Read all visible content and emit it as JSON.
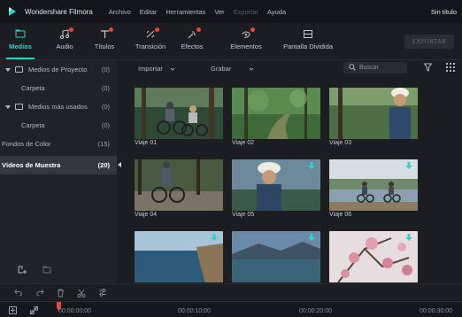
{
  "titlebar": {
    "app_name": "Wondershare Filmora",
    "menu": [
      "Archivo",
      "Editar",
      "Herramientas",
      "Ver",
      "Exportar",
      "Ayuda"
    ],
    "window_title": "Sin título"
  },
  "toolbar": {
    "tools": [
      {
        "label": "Medios",
        "icon": "folder-icon",
        "active": true,
        "dot": false
      },
      {
        "label": "Audio",
        "icon": "music-note-icon",
        "active": false,
        "dot": true
      },
      {
        "label": "Títulos",
        "icon": "title-text-icon",
        "active": false,
        "dot": true
      },
      {
        "label": "Transición",
        "icon": "transition-icon",
        "active": false,
        "dot": true
      },
      {
        "label": "Efectos",
        "icon": "effects-icon",
        "active": false,
        "dot": true
      },
      {
        "label": "Elementos",
        "icon": "elements-icon",
        "active": false,
        "dot": true
      },
      {
        "label": "Pantalla Dividida",
        "icon": "split-screen-icon",
        "active": false,
        "dot": false
      }
    ],
    "export_label": "EXPORTAR"
  },
  "sidebar": {
    "items": [
      {
        "label": "Medios de Proyecto",
        "count": "(0)",
        "type": "group"
      },
      {
        "label": "Carpeta",
        "count": "(0)",
        "type": "child"
      },
      {
        "label": "Medios más usados",
        "count": "(0)",
        "type": "group"
      },
      {
        "label": "Carpeta",
        "count": "(0)",
        "type": "child"
      },
      {
        "label": "Fondos de Color",
        "count": "(15)",
        "type": "root"
      },
      {
        "label": "Vídeos de Muestra",
        "count": "(20)",
        "type": "root",
        "selected": true
      }
    ],
    "bottom_icons": [
      "new-folder-icon",
      "folder-outline-icon"
    ]
  },
  "media": {
    "import_label": "Importar",
    "record_label": "Grabar",
    "search_placeholder": "Buscar",
    "items": [
      {
        "caption": "Viaje 01",
        "scene": "cyclists-forest",
        "download": false
      },
      {
        "caption": "Viaje 02",
        "scene": "forest-path",
        "download": false
      },
      {
        "caption": "Viaje 03",
        "scene": "cyclist-helmet-forest",
        "download": false
      },
      {
        "caption": "Viaje 04",
        "scene": "cyclist-rocky-forest",
        "download": false
      },
      {
        "caption": "Viaje 05",
        "scene": "cyclist-helmet-lake",
        "download": true
      },
      {
        "caption": "Viaje 06",
        "scene": "cyclists-lakeshore",
        "download": true
      },
      {
        "caption": "",
        "scene": "coastal-cliff",
        "download": true
      },
      {
        "caption": "",
        "scene": "mountain-lake",
        "download": true
      },
      {
        "caption": "",
        "scene": "pink-blossoms",
        "download": true
      }
    ]
  },
  "timeline": {
    "tools": [
      "undo-icon",
      "redo-icon",
      "delete-icon",
      "cut-icon",
      "adjust-icon"
    ],
    "timecodes": [
      "00:00:00:00",
      "00:00:10:00",
      "00:00:20:00",
      "00:00:30:00"
    ]
  },
  "colors": {
    "accent": "#2fd3c6",
    "notification": "#e8463c",
    "download": "#2fd3c6"
  }
}
